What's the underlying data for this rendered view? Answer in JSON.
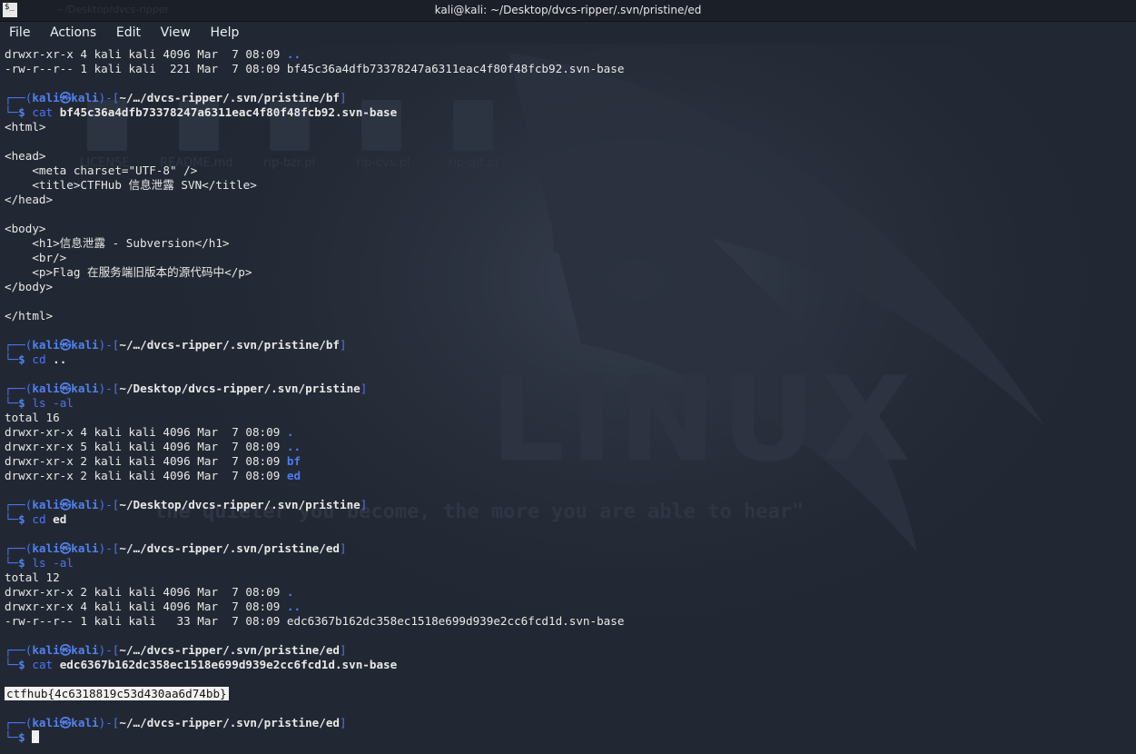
{
  "window": {
    "title": "kali@kali: ~/Desktop/dvcs-ripper/.svn/pristine/ed",
    "ghost_tab": "~/Desktop/dvcs-ripper"
  },
  "menu": [
    "File",
    "Actions",
    "Edit",
    "View",
    "Help"
  ],
  "prompt": {
    "user": "kali",
    "at": "㉿",
    "host": "kali",
    "symbol": "$",
    "branch_top": "┌──(",
    "branch_bottom": "└─"
  },
  "wallpaper": {
    "logo_text": "LINUX",
    "quote": "the quieter you become, the more you are able to hear\"",
    "icon_labels": [
      "LICENSE",
      "README.md",
      "rip-bzr.pl",
      "rip-cvs.pl",
      "rip-git.pl"
    ]
  },
  "terminal": {
    "lines": [
      {
        "type": "ls",
        "perm": "drwxr-xr-x",
        "meta": " 4 kali kali 4096 Mar  7 08:09 ",
        "name": "..",
        "dir": true
      },
      {
        "type": "ls",
        "perm": "-rw-r--r--",
        "meta": " 1 kali kali  221 Mar  7 08:09 ",
        "name": "bf45c36a4dfb73378247a6311eac4f80f48fcb92.svn-base",
        "dir": false
      },
      {
        "type": "blank"
      },
      {
        "type": "p1",
        "path": "~/…/dvcs-ripper/.svn/pristine/bf"
      },
      {
        "type": "p2",
        "cmd": "cat",
        "arg": " bf45c36a4dfb73378247a6311eac4f80f48fcb92.svn-base"
      },
      {
        "type": "out",
        "text": "<html>"
      },
      {
        "type": "blank"
      },
      {
        "type": "out",
        "text": "<head>"
      },
      {
        "type": "out",
        "text": "    <meta charset=\"UTF-8\" />"
      },
      {
        "type": "out",
        "text": "    <title>CTFHub 信息泄露 SVN</title>"
      },
      {
        "type": "out",
        "text": "</head>"
      },
      {
        "type": "blank"
      },
      {
        "type": "out",
        "text": "<body>"
      },
      {
        "type": "out",
        "text": "    <h1>信息泄露 - Subversion</h1>"
      },
      {
        "type": "out",
        "text": "    <br/>"
      },
      {
        "type": "out",
        "text": "    <p>Flag 在服务端旧版本的源代码中</p>"
      },
      {
        "type": "out",
        "text": "</body>"
      },
      {
        "type": "blank"
      },
      {
        "type": "out",
        "text": "</html>"
      },
      {
        "type": "blank"
      },
      {
        "type": "p1",
        "path": "~/…/dvcs-ripper/.svn/pristine/bf"
      },
      {
        "type": "p2",
        "cmd": "cd",
        "arg": " .."
      },
      {
        "type": "blank"
      },
      {
        "type": "p1",
        "path": "~/Desktop/dvcs-ripper/.svn/pristine"
      },
      {
        "type": "p2",
        "cmd": "ls -al",
        "arg": ""
      },
      {
        "type": "out",
        "text": "total 16"
      },
      {
        "type": "ls",
        "perm": "drwxr-xr-x",
        "meta": " 4 kali kali 4096 Mar  7 08:09 ",
        "name": ".",
        "dir": true
      },
      {
        "type": "ls",
        "perm": "drwxr-xr-x",
        "meta": " 5 kali kali 4096 Mar  7 08:09 ",
        "name": "..",
        "dir": true
      },
      {
        "type": "ls",
        "perm": "drwxr-xr-x",
        "meta": " 2 kali kali 4096 Mar  7 08:09 ",
        "name": "bf",
        "dir": true
      },
      {
        "type": "ls",
        "perm": "drwxr-xr-x",
        "meta": " 2 kali kali 4096 Mar  7 08:09 ",
        "name": "ed",
        "dir": true
      },
      {
        "type": "blank"
      },
      {
        "type": "p1",
        "path": "~/Desktop/dvcs-ripper/.svn/pristine"
      },
      {
        "type": "p2",
        "cmd": "cd",
        "arg": " ed"
      },
      {
        "type": "blank"
      },
      {
        "type": "p1",
        "path": "~/…/dvcs-ripper/.svn/pristine/ed"
      },
      {
        "type": "p2",
        "cmd": "ls -al",
        "arg": ""
      },
      {
        "type": "out",
        "text": "total 12"
      },
      {
        "type": "ls",
        "perm": "drwxr-xr-x",
        "meta": " 2 kali kali 4096 Mar  7 08:09 ",
        "name": ".",
        "dir": true
      },
      {
        "type": "ls",
        "perm": "drwxr-xr-x",
        "meta": " 4 kali kali 4096 Mar  7 08:09 ",
        "name": "..",
        "dir": true
      },
      {
        "type": "ls",
        "perm": "-rw-r--r--",
        "meta": " 1 kali kali   33 Mar  7 08:09 ",
        "name": "edc6367b162dc358ec1518e699d939e2cc6fcd1d.svn-base",
        "dir": false
      },
      {
        "type": "blank"
      },
      {
        "type": "p1",
        "path": "~/…/dvcs-ripper/.svn/pristine/ed"
      },
      {
        "type": "p2",
        "cmd": "cat",
        "arg": " edc6367b162dc358ec1518e699d939e2cc6fcd1d.svn-base"
      },
      {
        "type": "blank"
      },
      {
        "type": "flag",
        "text": "ctfhub{4c6318819c53d430aa6d74bb}"
      },
      {
        "type": "blank"
      },
      {
        "type": "p1",
        "path": "~/…/dvcs-ripper/.svn/pristine/ed"
      },
      {
        "type": "p2",
        "cmd": "",
        "arg": "",
        "cursor": true
      }
    ]
  },
  "colors": {
    "background": "#222833",
    "prompt_blue": "#5181ef",
    "directory_blue": "#4d7cf5",
    "text": "#e8e8e8"
  }
}
